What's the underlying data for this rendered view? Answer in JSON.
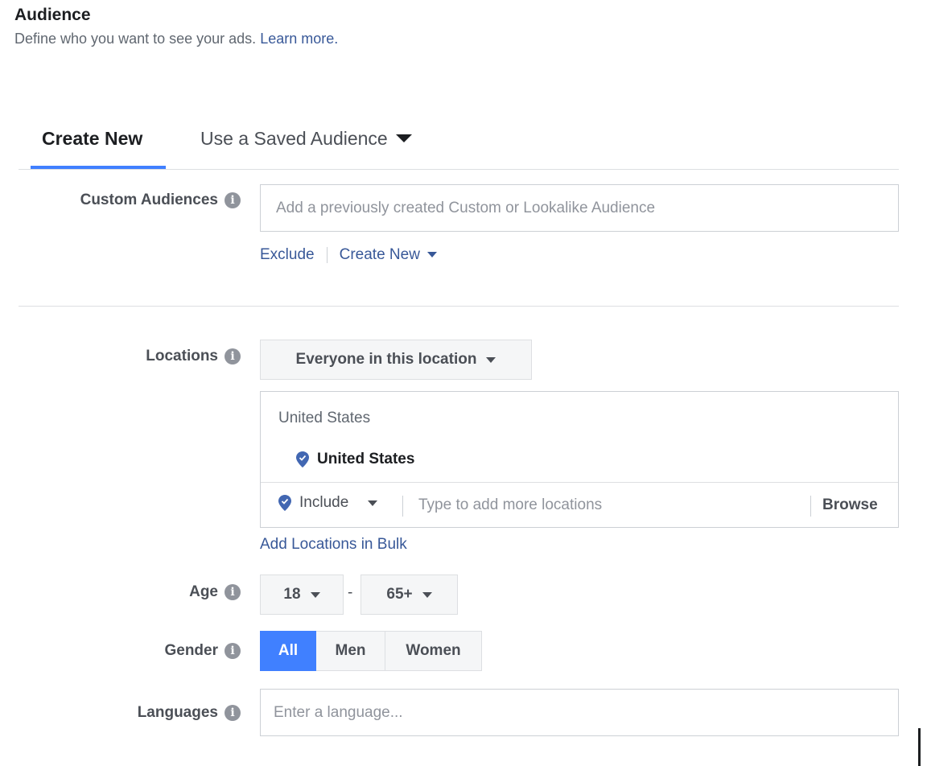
{
  "header": {
    "title": "Audience",
    "subtitle": "Define who you want to see your ads.",
    "learn_more": "Learn more."
  },
  "tabs": [
    {
      "label": "Create New",
      "active": true
    },
    {
      "label": "Use a Saved Audience",
      "active": false
    }
  ],
  "custom_audiences": {
    "label": "Custom Audiences",
    "placeholder": "Add a previously created Custom or Lookalike Audience",
    "exclude": "Exclude",
    "create_new": "Create New"
  },
  "locations": {
    "label": "Locations",
    "mode": "Everyone in this location",
    "group_title": "United States",
    "selected": "United States",
    "include": "Include",
    "placeholder": "Type to add more locations",
    "browse": "Browse",
    "bulk_link": "Add Locations in Bulk"
  },
  "age": {
    "label": "Age",
    "min": "18",
    "separator": "-",
    "max": "65+"
  },
  "gender": {
    "label": "Gender",
    "options": [
      "All",
      "Men",
      "Women"
    ],
    "selected": "All"
  },
  "languages": {
    "label": "Languages",
    "placeholder": "Enter a language..."
  },
  "colors": {
    "accent": "#4080ff",
    "link": "#385898",
    "pin": "#4267b2"
  }
}
